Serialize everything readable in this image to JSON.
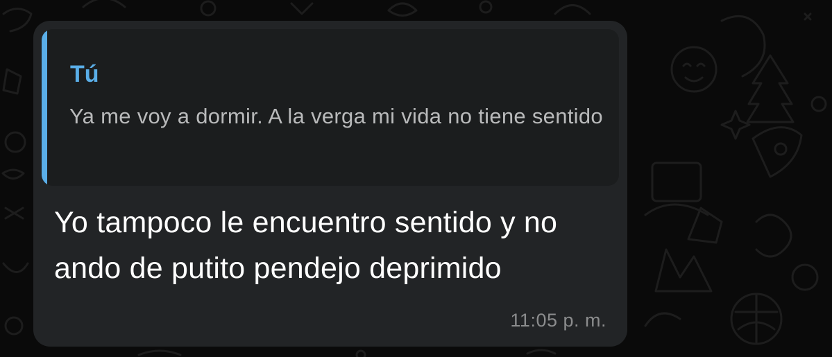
{
  "background": {
    "pattern": "chat-doodle-wallpaper",
    "color": "#0a0a0a"
  },
  "message": {
    "bubble_color": "#222426",
    "reply_quote": {
      "author": "Tú",
      "author_color": "#5aaee8",
      "text": "Ya me voy a dormir. A la verga mi vida no tiene sentido"
    },
    "text": "Yo tampoco le encuentro sentido y no ando de putito pendejo deprimido",
    "time": "11:05 p. m."
  }
}
